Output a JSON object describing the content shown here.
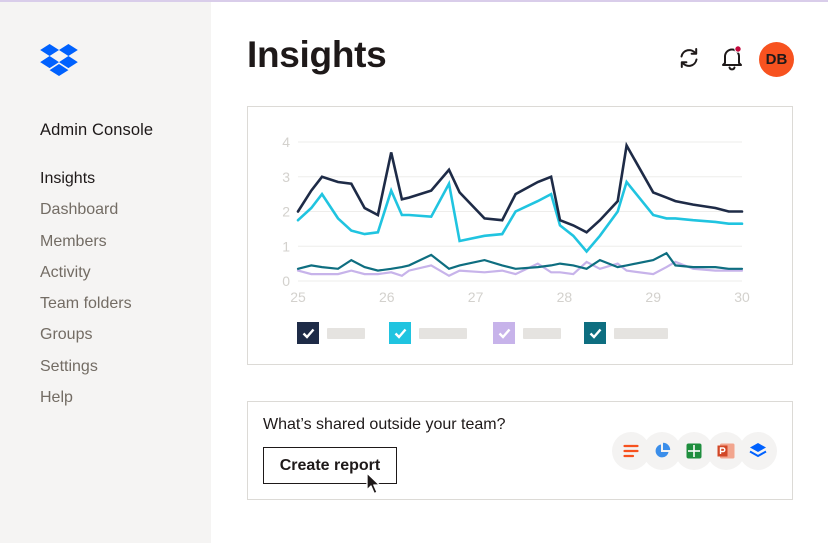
{
  "app": {
    "console_title": "Admin Console",
    "logo": "dropbox-logo"
  },
  "sidebar": {
    "items": [
      {
        "label": "Insights",
        "active": true
      },
      {
        "label": "Dashboard"
      },
      {
        "label": "Members"
      },
      {
        "label": "Activity"
      },
      {
        "label": "Team folders"
      },
      {
        "label": "Groups"
      },
      {
        "label": "Settings"
      },
      {
        "label": "Help"
      }
    ]
  },
  "header": {
    "title": "Insights",
    "refresh_icon": "refresh-icon",
    "notification_icon": "bell-icon",
    "avatar_initials": "DB",
    "colors": {
      "avatar": "#f7521f",
      "notification_dot": "#c4083c"
    }
  },
  "chart_data": {
    "type": "line",
    "x": [
      25,
      25.15,
      25.27,
      25.45,
      25.6,
      25.75,
      25.9,
      26.05,
      26.17,
      26.25,
      26.5,
      26.7,
      26.82,
      27.1,
      27.3,
      27.45,
      27.7,
      27.85,
      27.95,
      28.1,
      28.25,
      28.4,
      28.6,
      28.7,
      29.0,
      29.15,
      29.25,
      29.45,
      29.7,
      29.85,
      30.0
    ],
    "xlim": [
      25,
      30
    ],
    "ylim": [
      0,
      4
    ],
    "x_ticks": [
      "25",
      "26",
      "27",
      "28",
      "29",
      "30"
    ],
    "y_ticks": [
      "0",
      "1",
      "2",
      "3",
      "4"
    ],
    "grid": true,
    "series": [
      {
        "color": "#1e2b47",
        "values": [
          2.0,
          2.6,
          3.0,
          2.85,
          2.8,
          2.1,
          1.9,
          3.7,
          2.35,
          2.4,
          2.6,
          3.2,
          2.55,
          1.8,
          1.75,
          2.5,
          2.85,
          3.0,
          1.75,
          1.6,
          1.4,
          1.75,
          2.3,
          3.9,
          2.55,
          2.4,
          2.3,
          2.2,
          2.1,
          2.0,
          2.0
        ],
        "checked": true
      },
      {
        "color": "#20c4e0",
        "values": [
          1.75,
          2.1,
          2.5,
          1.8,
          1.45,
          1.35,
          1.4,
          2.6,
          1.9,
          1.9,
          1.85,
          2.8,
          1.15,
          1.3,
          1.35,
          2.0,
          2.3,
          2.5,
          1.6,
          1.3,
          0.85,
          1.3,
          2.0,
          2.85,
          1.9,
          1.8,
          1.8,
          1.75,
          1.7,
          1.65,
          1.65
        ],
        "checked": true
      },
      {
        "color": "#c7b3ea",
        "values": [
          0.3,
          0.2,
          0.2,
          0.2,
          0.3,
          0.2,
          0.2,
          0.25,
          0.15,
          0.3,
          0.45,
          0.15,
          0.3,
          0.25,
          0.3,
          0.2,
          0.5,
          0.25,
          0.25,
          0.2,
          0.55,
          0.35,
          0.5,
          0.3,
          0.2,
          0.4,
          0.55,
          0.35,
          0.3,
          0.3,
          0.3
        ],
        "checked": true
      },
      {
        "color": "#0e6e80",
        "values": [
          0.35,
          0.45,
          0.4,
          0.35,
          0.6,
          0.4,
          0.3,
          0.35,
          0.4,
          0.45,
          0.75,
          0.35,
          0.45,
          0.6,
          0.45,
          0.35,
          0.4,
          0.45,
          0.5,
          0.45,
          0.35,
          0.6,
          0.4,
          0.45,
          0.6,
          0.8,
          0.45,
          0.4,
          0.4,
          0.35,
          0.35
        ],
        "checked": true
      }
    ]
  },
  "share": {
    "question": "What’s shared outside your team?",
    "button_label": "Create report",
    "file_types": [
      {
        "icon": "document-icon",
        "color": "#f7521f"
      },
      {
        "icon": "pie-chart-icon",
        "color": "#3b8eea"
      },
      {
        "icon": "spreadsheet-icon",
        "color": "#1e8e3e"
      },
      {
        "icon": "presentation-icon",
        "color": "#d24726"
      },
      {
        "icon": "dropbox-stack-icon",
        "color": "#0061fe"
      }
    ]
  }
}
